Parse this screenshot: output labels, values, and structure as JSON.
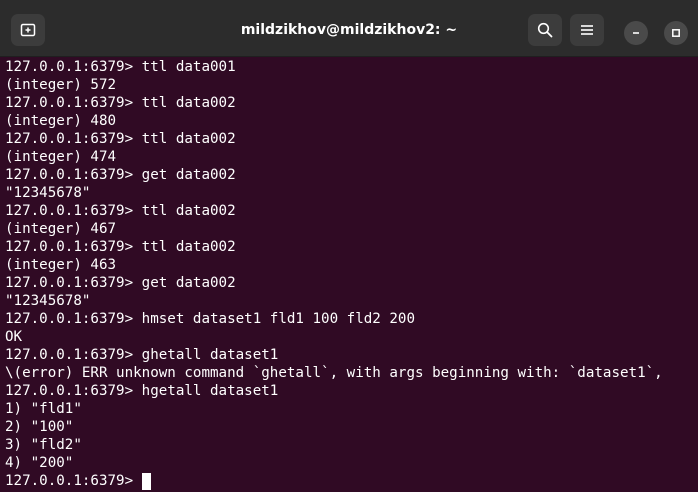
{
  "window": {
    "title": "mildzikhov@mildzikhov2: ~",
    "new_tab_icon": "new-tab-icon",
    "search_icon": "search-icon",
    "menu_icon": "hamburger-menu-icon",
    "minimize_icon": "minimize-icon",
    "maximize_icon": "maximize-icon"
  },
  "colors": {
    "terminal_background": "#300a24",
    "titlebar_background": "#2c2c2c",
    "text": "#ffffff"
  },
  "terminal": {
    "lines": [
      "127.0.0.1:6379> ttl data001",
      "(integer) 572",
      "127.0.0.1:6379> ttl data002",
      "(integer) 480",
      "127.0.0.1:6379> ttl data002",
      "(integer) 474",
      "127.0.0.1:6379> get data002",
      "\"12345678\"",
      "127.0.0.1:6379> ttl data002",
      "(integer) 467",
      "127.0.0.1:6379> ttl data002",
      "(integer) 463",
      "127.0.0.1:6379> get data002",
      "\"12345678\"",
      "127.0.0.1:6379> hmset dataset1 fld1 100 fld2 200",
      "OK",
      "127.0.0.1:6379> ghetall dataset1",
      "\\(error) ERR unknown command `ghetall`, with args beginning with: `dataset1`,",
      "127.0.0.1:6379> hgetall dataset1",
      "1) \"fld1\"",
      "2) \"100\"",
      "3) \"fld2\"",
      "4) \"200\""
    ],
    "current_prompt": "127.0.0.1:6379> "
  }
}
